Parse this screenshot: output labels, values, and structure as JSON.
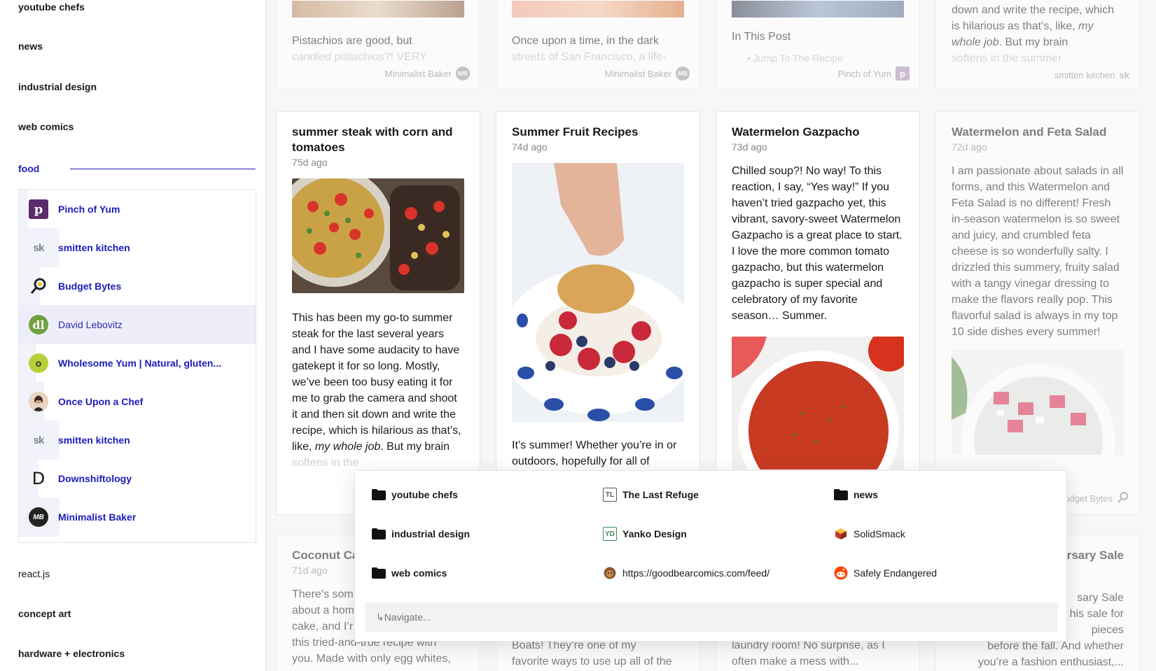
{
  "sidebar": {
    "folders_top": [
      "youtube chefs",
      "news",
      "industrial design",
      "web comics"
    ],
    "active_folder": "food",
    "feeds": [
      {
        "label": "Pinch of Yum",
        "icon": "pinch-of-yum-icon"
      },
      {
        "label": "smitten kitchen",
        "icon": "smitten-kitchen-icon"
      },
      {
        "label": "Budget Bytes",
        "icon": "budget-bytes-icon"
      },
      {
        "label": "David Lebovitz",
        "icon": "david-lebovitz-icon"
      },
      {
        "label": "Wholesome Yum | Natural, gluten...",
        "icon": "wholesome-yum-icon"
      },
      {
        "label": "Once Upon a Chef",
        "icon": "once-upon-a-chef-icon"
      },
      {
        "label": "smitten kitchen",
        "icon": "smitten-kitchen-icon"
      },
      {
        "label": "Downshiftology",
        "icon": "downshiftology-icon"
      },
      {
        "label": "Minimalist Baker",
        "icon": "minimalist-baker-icon"
      }
    ],
    "folders_bottom": [
      "react.js",
      "concept art",
      "hardware + electronics"
    ]
  },
  "top_cards": [
    {
      "excerpt": "Pistachios are good, but",
      "excerpt2_italic": "candied",
      "excerpt2_rest": " pistachios?! VERY",
      "source": "Minimalist Baker"
    },
    {
      "excerpt": "Once upon a time, in the dark",
      "excerpt2_rest": "streets of San Francisco, a life-",
      "source": "Minimalist Baker"
    },
    {
      "excerpt": "In This Post",
      "excerpt2_rest": "• Jump To The Recipe",
      "source": "Pinch of Yum"
    },
    {
      "excerpt": "down and write the recipe, which is hilarious as that’s, like,",
      "excerpt_italic": "my whole job",
      "excerpt_after": ". But my brain",
      "excerpt2_rest": "softens in the summer",
      "source": "smitten kitchen"
    }
  ],
  "cards": [
    {
      "title": "summer steak with corn and tomatoes",
      "age": "75d ago",
      "body": "This has been my go-to summer steak for the last several years and I have some audacity to have gatekept it for so long. Mostly, we’ve been too busy eating it for me to grab the camera and shoot it and then sit down and write the recipe, which is hilarious as that’s, like,",
      "body_italic": "my whole job",
      "body_after": ". But my brain",
      "body_faded": "softens in the"
    },
    {
      "title": "Summer Fruit Recipes",
      "age": "74d ago",
      "body": "It’s summer! Whether you’re in or outdoors, hopefully for all of"
    },
    {
      "title": "Watermelon Gazpacho",
      "age": "73d ago",
      "body": "Chilled soup?! No way! To this reaction, I say, “Yes way!” If you haven’t tried gazpacho yet, this vibrant, savory-sweet Watermelon Gazpacho is a great place to start. I love the more common tomato gazpacho, but this watermelon gazpacho is super special and celebratory of my favorite season… Summer."
    },
    {
      "title": "Watermelon and Feta Salad",
      "age": "72d ago",
      "body": "I am passionate about salads in all forms, and this Watermelon and Feta Salad is no different! Fresh in-season watermelon is so sweet and juicy, and crumbled feta cheese is so wonderfully salty. I drizzled this summery, fruity salad with a tangy vinegar dressing to make the flavors really pop. This flavorful salad is always in my top 10 side dishes every summer!",
      "source": "Budget Bytes"
    }
  ],
  "bottom_cards": [
    {
      "title": "Coconut Ca",
      "age": "71d ago",
      "body": "There’s som\nabout a hom\ncake, and I’r\nthis tried-and-true recipe with\nyou. Made with only egg whites,"
    },
    {
      "body": "Boats! They’re one of my\nfavorite ways to use up all of the"
    },
    {
      "body": "laundry room! No surprise, as I\noften make a mess with..."
    },
    {
      "title": "rsary Sale",
      "body": "sary Sale\nhis sale for\npieces\nbefore the fall. And whether\nyou’re a fashion enthusiast,..."
    }
  ],
  "palette": {
    "items": [
      {
        "label": "youtube chefs",
        "icon": "folder-icon",
        "bold": true
      },
      {
        "label": "The Last Refuge",
        "icon": "tl-icon",
        "bold": true
      },
      {
        "label": "news",
        "icon": "folder-icon",
        "bold": true
      },
      {
        "label": "industrial design",
        "icon": "folder-icon",
        "bold": true
      },
      {
        "label": "Yanko Design",
        "icon": "yd-icon",
        "bold": true
      },
      {
        "label": "SolidSmack",
        "icon": "cube-icon",
        "bold": false
      },
      {
        "label": "web comics",
        "icon": "folder-icon",
        "bold": true
      },
      {
        "label": "https://goodbearcomics.com/feed/",
        "icon": "bear-icon",
        "bold": false
      },
      {
        "label": "Safely Endangered",
        "icon": "reddit-icon",
        "bold": false
      }
    ],
    "input_placeholder": "↳Navigate..."
  }
}
